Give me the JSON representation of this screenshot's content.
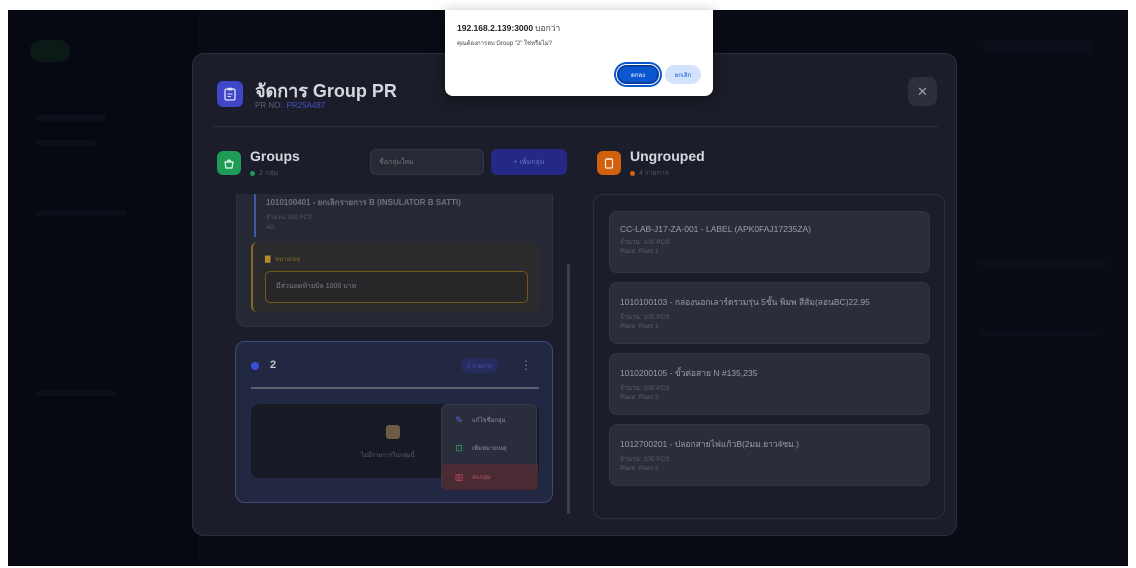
{
  "dialog": {
    "host": "192.168.2.139:3000",
    "suffix": "บอกว่า",
    "message": "คุณต้องการลบ Group \"2\" ใช่หรือไม่?",
    "ok_label": "ตกลง",
    "cancel_label": "ยกเลิก"
  },
  "modal": {
    "title": "จัดการ Group PR",
    "pr_label": "PR NO:",
    "pr_value": "PR25A487",
    "close_label": "✕"
  },
  "groups": {
    "title": "Groups",
    "count": "2 กลุ่ม",
    "name_placeholder": "ชื่อกลุ่มใหม่",
    "add_label": "+ เพิ่มกลุ่ม",
    "group1": {
      "item_title": "1010100401 - ยกเลิกรายการ B (INSULATOR B SATTI)",
      "item_qty": "จำนวน: 100 PCS",
      "item_plant": "AD",
      "note_label": "หมายเหตุ",
      "note_text": "มีส่วนลดท้ายบิล 1000 บาท"
    },
    "group2": {
      "name": "2",
      "badge": "0 รายการ",
      "empty_text": "ไม่มีรายการในกลุ่มนี้",
      "menu": {
        "edit": "แก้ไขชื่อกลุ่ม",
        "note": "เพิ่มหมายเหตุ",
        "delete": "ลบกลุ่ม"
      }
    }
  },
  "ungrouped": {
    "title": "Ungrouped",
    "count": "4 รายการ",
    "items": [
      {
        "title": "CC-LAB-J17-ZA-001 - LABEL (APK0FAJ17235ZA)",
        "qty": "จำนวน: 100 PCS",
        "plant": "Plant: Plant 1"
      },
      {
        "title": "1010100103 - กล่องนอกเลาร์ดรวมรุ่น 5ชั้น พิมพ สีส้ม(ลอนBC)22.95",
        "qty": "จำนวน: 100 PCS",
        "plant": "Plant: Plant 1"
      },
      {
        "title": "1010200105 - ขั้วต่อสาย N #135,235",
        "qty": "จำนวน: 100 PCS",
        "plant": "Plant: Plant 2"
      },
      {
        "title": "1012700201 - ปลอกสายไฟแก้วB(2มม.ยาว4ซม.)",
        "qty": "จำนวน: 100 PCS",
        "plant": "Plant: Plant 2"
      }
    ]
  },
  "colors": {
    "accent": "#3f46c8",
    "groups_icon": "#1f9a57",
    "ungrouped_icon": "#d2610e",
    "dialog_ok": "#0b57d0"
  }
}
